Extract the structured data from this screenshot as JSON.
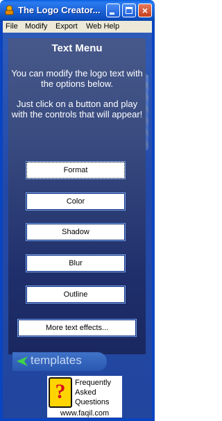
{
  "window": {
    "title": "The Logo Creator...",
    "controls": {
      "minimize": "minimize",
      "maximize": "maximize",
      "close": "×"
    }
  },
  "menu": [
    "File",
    "Modify",
    "Export",
    "Web Help"
  ],
  "panel": {
    "title": "Text Menu",
    "intro": "You can modify the logo text with the options below.",
    "instructions": "Just click on a button and play with the controls that will appear!",
    "buttons": [
      "Format",
      "Color",
      "Shadow",
      "Blur",
      "Outline"
    ],
    "more_button": "More text effects..."
  },
  "templates_link": "templates",
  "faq": {
    "line1": "Frequently",
    "line2": "Asked",
    "line3": "Questions",
    "icon_glyph": "?",
    "url": "www.faqil.com"
  },
  "colors": {
    "titlebar": "#1d64d8",
    "panel_bg": "#2a3c78",
    "client_bg": "#2349a8",
    "faq_icon": "#ffd400"
  }
}
